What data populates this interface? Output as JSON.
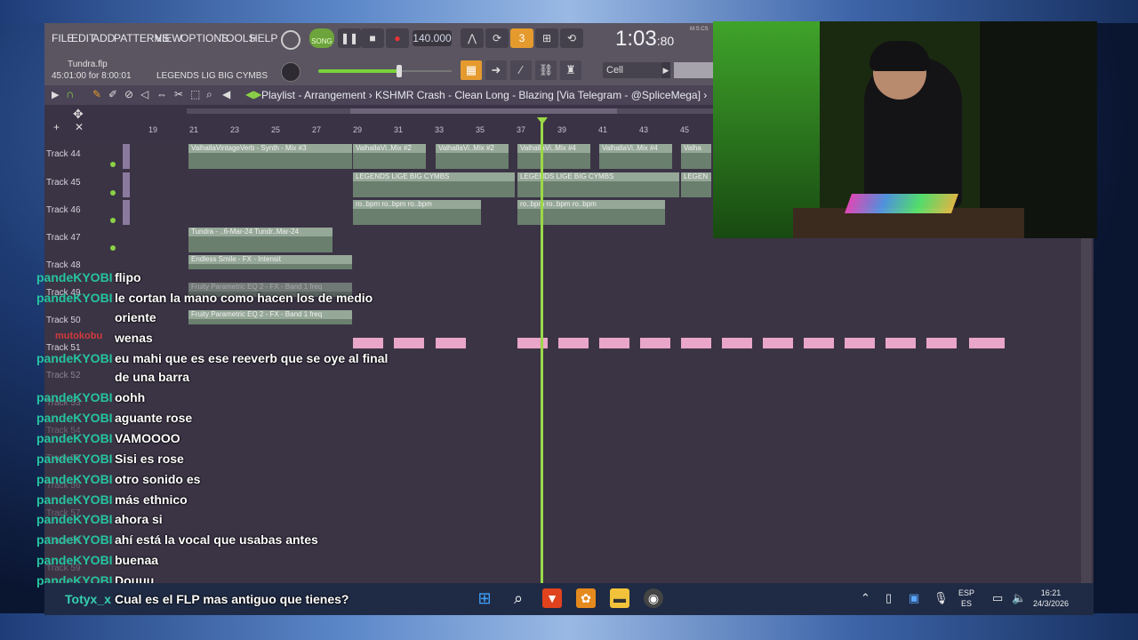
{
  "menu": [
    "FILE",
    "EDIT",
    "ADD",
    "PATTERNS",
    "VIEW",
    "OPTIONS",
    "TOOLS",
    "HELP"
  ],
  "file_info": {
    "name": "Tundra.flp",
    "time": "45:01:00 for 8:00:01",
    "pattern": "LEGENDS LIG BIG CYMBS"
  },
  "transport": {
    "mode": "SONG",
    "tempo": "140.000",
    "time_main": "1:03",
    "time_sub": "80",
    "time_unit": "M:S:CS"
  },
  "snap": "Cell",
  "playlist": {
    "title": "Playlist - Arrangement › KSHMR Crash - Clean Long - Blazing [Via Telegram - @SpliceMega] ›"
  },
  "ruler": [
    "19",
    "21",
    "23",
    "25",
    "27",
    "29",
    "31",
    "33",
    "35",
    "37",
    "39",
    "41",
    "43",
    "45"
  ],
  "tracks": [
    "Track 44",
    "Track 45",
    "Track 46",
    "Track 47",
    "Track 48",
    "Track 49",
    "Track 50",
    "Track 51",
    "Track 52",
    "Track 53",
    "Track 54",
    "Track 55",
    "Track 56",
    "Track 57",
    "Track 58",
    "Track 59"
  ],
  "clips": {
    "c1": "ValhallaVintageVerb - Synth - Mix #3",
    "c2": "ValhallaVi..Mix #2",
    "c3": "ValhallaVi..Mix #2",
    "c4": "ValhallaVi..Mix #4",
    "c5": "ValhallaVi..Mix #4",
    "c6": "Valha",
    "c7": "LEGENDS LIGE BIG CYMBS",
    "c8": "LEGENDS LIGE BIG CYMBS",
    "c9": "LEGEN",
    "c10": "ro..bpm ro..bpm ro..bpm",
    "c11": "ro..bpm ro..bpm ro..bpm",
    "c12": "Tundra - ..6-Mar-24 Tundr..Mar-24",
    "c13": "Endless Smile - FX - Intensit",
    "c14": "Fruity Parametric EQ 2 - FX - Band 1 freq",
    "c15": "Fruity Parametric EQ 2 - FX - Band 1 freq"
  },
  "chat": [
    {
      "user": "pandeKYOBI",
      "msg": "flipo"
    },
    {
      "user": "pandeKYOBI",
      "msg": "le cortan la mano como hacen los de medio"
    },
    {
      "user": "",
      "msg": "oriente"
    },
    {
      "user": "mutokobu",
      "msg": "wenas"
    },
    {
      "user": "pandeKYOBI",
      "msg": "eu mahi que es ese reeverb que se oye al final"
    },
    {
      "user": "",
      "msg": "de una barra"
    },
    {
      "user": "pandeKYOBI",
      "msg": "oohh"
    },
    {
      "user": "pandeKYOBI",
      "msg": "aguante rose"
    },
    {
      "user": "pandeKYOBI",
      "msg": "VAMOOOO"
    },
    {
      "user": "pandeKYOBI",
      "msg": "Sisi es rose"
    },
    {
      "user": "pandeKYOBI",
      "msg": "otro sonido es"
    },
    {
      "user": "pandeKYOBI",
      "msg": "más ethnico"
    },
    {
      "user": "pandeKYOBI",
      "msg": "ahora si"
    },
    {
      "user": "pandeKYOBI",
      "msg": "ahí está la vocal que usabas antes"
    },
    {
      "user": "pandeKYOBI",
      "msg": "buenaa"
    },
    {
      "user": "pandeKYOBI",
      "msg": "Douuu"
    },
    {
      "user": "Totyx_x",
      "msg": "Cual es el FLP mas antiguo que tienes?"
    }
  ],
  "taskbar": {
    "lang1": "ESP",
    "lang2": "ES",
    "clock_time": "16:21",
    "clock_date": "24/3/2026"
  },
  "colors": {
    "chat_user": "#25c4a0",
    "accent_green": "#9bd948",
    "playlist_bg": "#3b3445"
  }
}
